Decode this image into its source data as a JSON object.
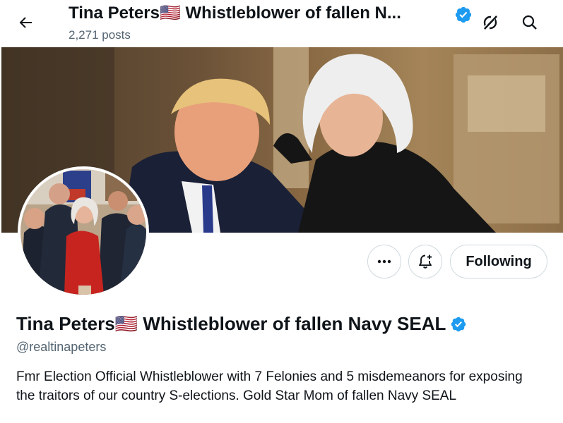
{
  "header": {
    "title": "Tina Peters🇺🇸 Whistleblower of fallen N...",
    "post_count": "2,271 posts",
    "back_icon": "arrow-left-icon",
    "grok_icon": "grok-icon",
    "search_icon": "search-icon"
  },
  "banner": {
    "image": "photo of two people posing indoors"
  },
  "avatar": {
    "image": "photo of a woman in red jacket with uniformed officers"
  },
  "actions": {
    "more_icon": "more-dots-icon",
    "notify_icon": "bell-plus-icon",
    "follow_label": "Following"
  },
  "profile": {
    "name": "Tina Peters🇺🇸 Whistleblower of fallen Navy SEAL",
    "handle": "@realtinapeters",
    "bio": "Fmr Election Official Whistleblower with 7 Felonies and 5 misdemeanors for exposing the traitors of our country S-elections. Gold Star Mom of fallen Navy SEAL"
  },
  "colors": {
    "verified_blue": "#1d9bf0",
    "secondary_text": "#536471",
    "border": "#cfd9de"
  }
}
